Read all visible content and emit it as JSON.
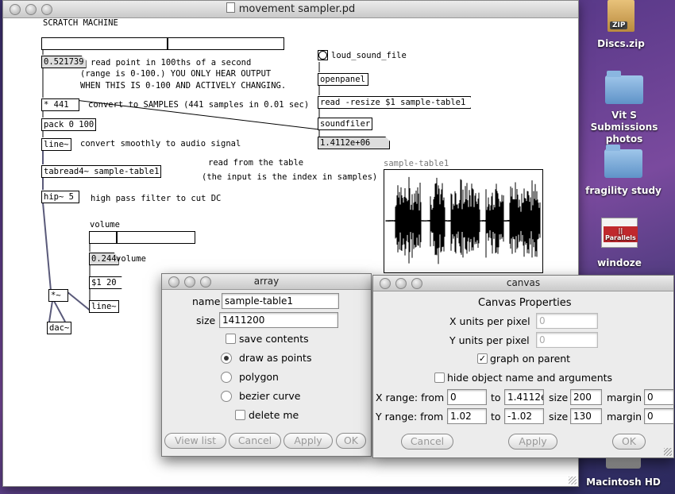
{
  "desktop": {
    "icons": [
      {
        "label": "Discs.zip",
        "badge": "ZIP"
      },
      {
        "label": "Vit S Submissions photos"
      },
      {
        "label": "fragility study"
      },
      {
        "label": "windoze",
        "badge": "|| Parallels"
      },
      {
        "label": "Macintosh HD"
      }
    ]
  },
  "pd_window": {
    "title": "movement sampler.pd",
    "comments": {
      "scratch": "SCRATCH MACHINE",
      "read_point_1": "read point in 100ths of a second",
      "read_point_2": "(range is 0-100.) YOU ONLY HEAR OUTPUT",
      "read_point_3": "WHEN THIS IS 0-100 AND ACTIVELY CHANGING.",
      "convert_samples": "convert to SAMPLES (441 samples in 0.01 sec)",
      "convert_smooth": "convert smoothly to audio signal",
      "read_table_1": "read from the table",
      "read_table_2": "(the input is the index in samples)",
      "highpass": "high pass filter to cut DC",
      "volume_title": "volume",
      "volume_label": "volume",
      "bang_label": "loud_sound_file"
    },
    "numbers": {
      "read_point": "0.521739",
      "soundfiler_out": "1.4112e+06",
      "volume": "0.244"
    },
    "objects": {
      "mult441": "* 441",
      "pack": "pack 0 100",
      "line": "line~",
      "tabread": "tabread4~ sample-table1",
      "hip": "hip~ 5",
      "mult": "*~",
      "dac": "dac~",
      "soundfiler": "soundfiler",
      "line2": "line~"
    },
    "messages": {
      "openpanel": "openpanel",
      "read": "read -resize $1 sample-table1",
      "ramp": "$1 20"
    },
    "sliders": {
      "read_point_level": 0.52,
      "volume_level": 0.25
    },
    "graph_label": "sample-table1"
  },
  "array_dialog": {
    "title": "array",
    "name_label": "name",
    "name_value": "sample-table1",
    "size_label": "size",
    "size_value": "1411200",
    "save_contents": "save contents",
    "save_checked": false,
    "styles": [
      "draw as points",
      "polygon",
      "bezier curve"
    ],
    "selected_style": "draw as points",
    "delete_me": "delete me",
    "buttons": {
      "view_list": "View list",
      "cancel": "Cancel",
      "apply": "Apply",
      "ok": "OK"
    }
  },
  "canvas_dialog": {
    "title": "canvas",
    "heading": "Canvas Properties",
    "x_units_label": "X units per pixel",
    "x_units_value": "0",
    "y_units_label": "Y units per pixel",
    "y_units_value": "0",
    "graph_on_parent": "graph on parent",
    "graph_on_parent_checked": true,
    "hide_name": "hide object name and arguments",
    "hide_name_checked": false,
    "x_range": {
      "label": "X range: from",
      "from": "0",
      "to_label": "to",
      "to": "1.4112e",
      "size_label": "size",
      "size": "200",
      "margin_label": "margin",
      "margin": "0"
    },
    "y_range": {
      "label": "Y range: from",
      "from": "1.02",
      "to_label": "to",
      "to": "-1.02",
      "size_label": "size",
      "size": "130",
      "margin_label": "margin",
      "margin": "0"
    },
    "buttons": {
      "cancel": "Cancel",
      "apply": "Apply",
      "ok": "OK"
    }
  }
}
